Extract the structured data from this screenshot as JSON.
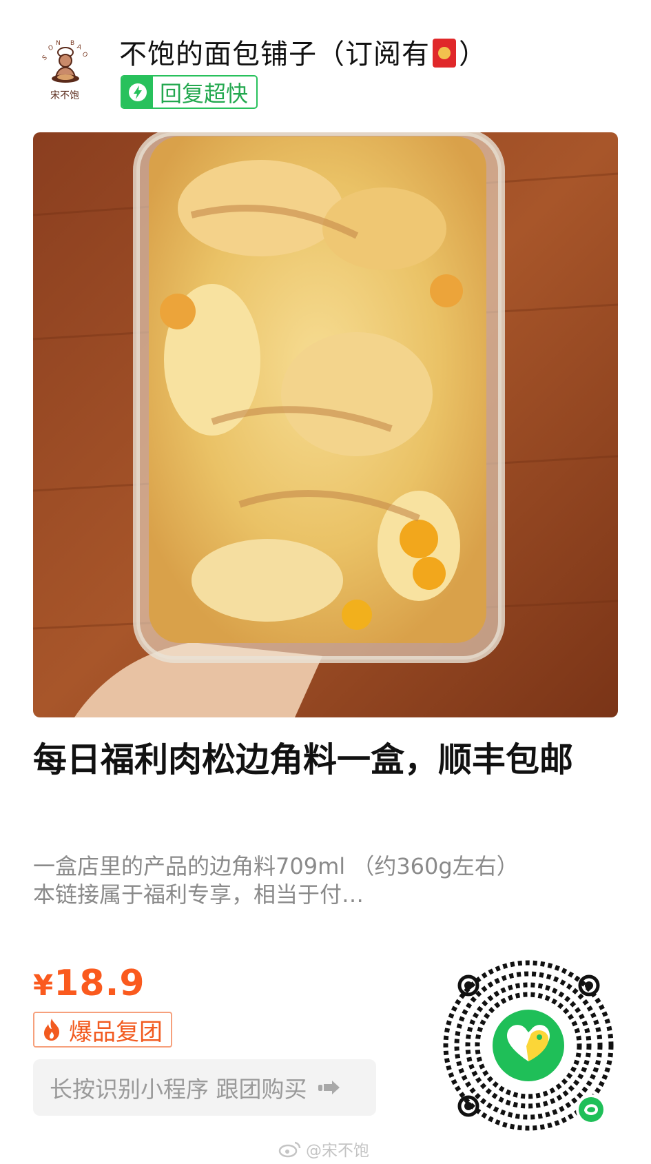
{
  "shop": {
    "logo_text": "宋不饱",
    "logo_arc_text": "SONG BU BAO",
    "name": "不饱的面包铺子（订阅有",
    "name_suffix": "）",
    "fu_icon": "red-envelope-fu-icon",
    "reply_badge": "回复超快"
  },
  "product": {
    "photo_icon": "product-photo",
    "title": "每日福利肉松边角料一盒，顺丰包邮",
    "description_line1": "一盒店里的产品的边角料709ml （约360g左右）",
    "description_line2": "本链接属于福利专享，相当于付…",
    "currency": "¥",
    "price": "18.9",
    "hot_tag": "爆品复团",
    "cta": "长按识别小程序 跟团购买"
  },
  "colors": {
    "accent_green": "#28c15c",
    "price_orange": "#fa5a1e"
  },
  "watermark": "@宋不饱"
}
